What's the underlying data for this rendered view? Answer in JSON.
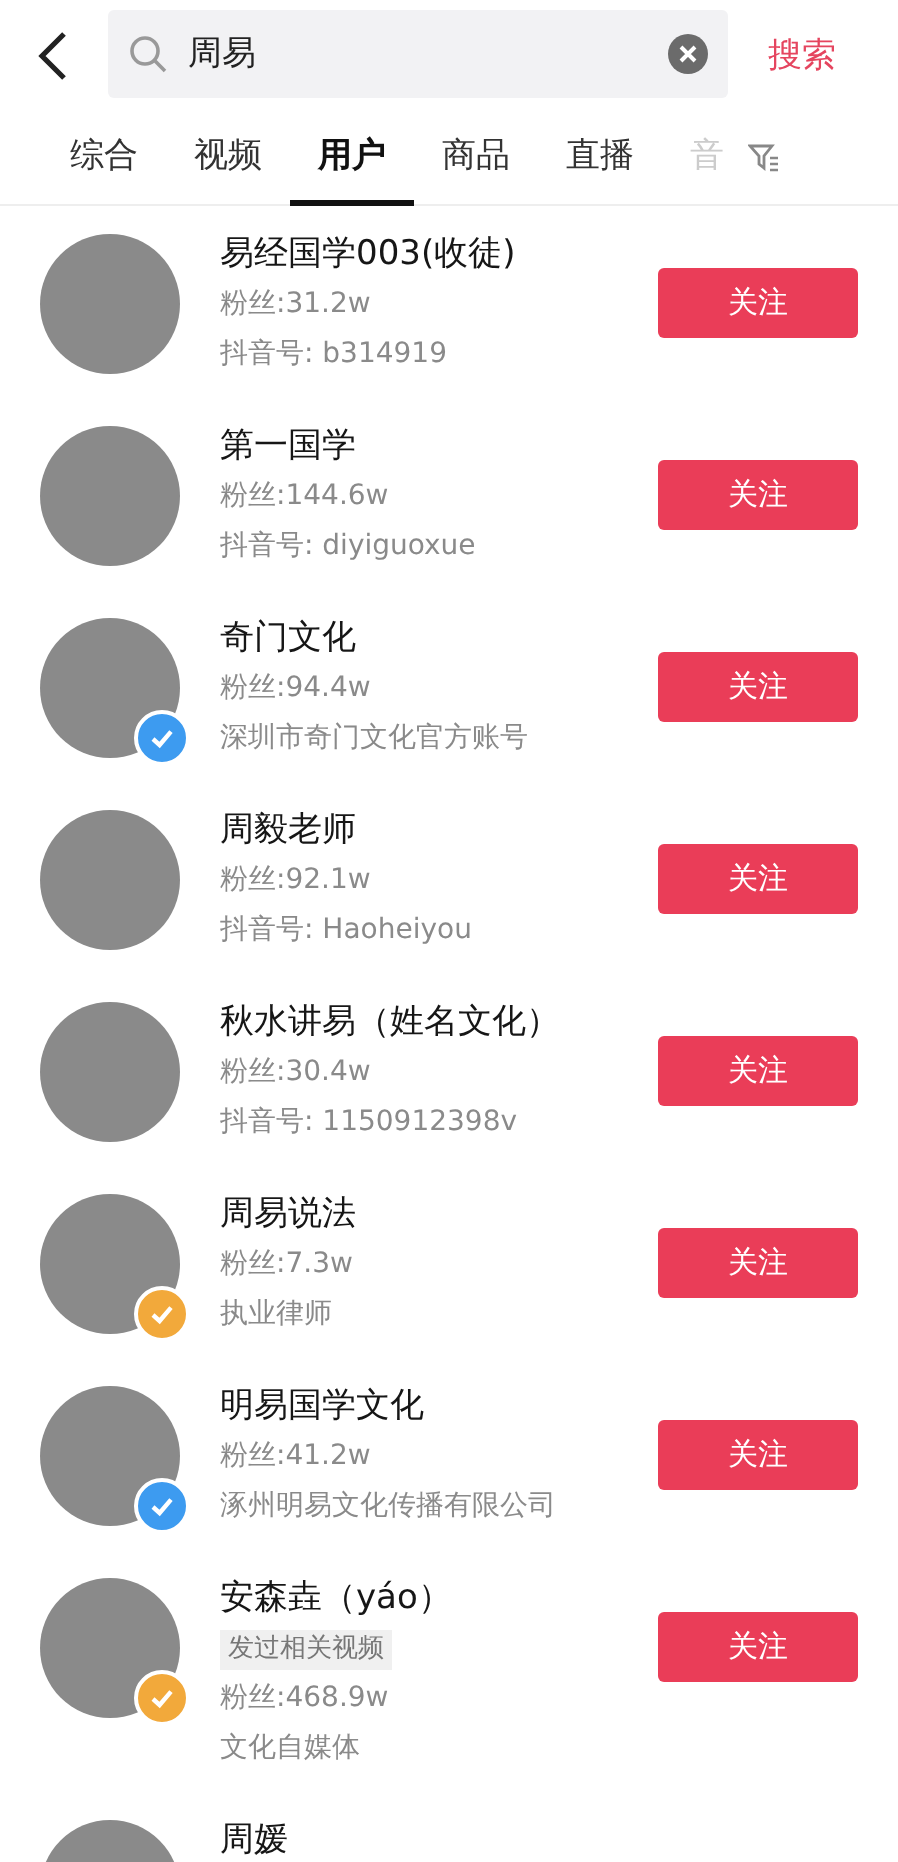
{
  "search": {
    "value": "周易",
    "action": "搜索"
  },
  "tabs": [
    {
      "label": "综合",
      "selected": false,
      "faded": false
    },
    {
      "label": "视频",
      "selected": false,
      "faded": false
    },
    {
      "label": "用户",
      "selected": true,
      "faded": false
    },
    {
      "label": "商品",
      "selected": false,
      "faded": false
    },
    {
      "label": "直播",
      "selected": false,
      "faded": false
    },
    {
      "label": "音",
      "selected": false,
      "faded": true
    }
  ],
  "users": [
    {
      "name": "易经国学003(收徒)",
      "fans": "粉丝:31.2w",
      "info": "抖音号: b314919",
      "button": "关注"
    },
    {
      "name": "第一国学",
      "fans": "粉丝:144.6w",
      "info": "抖音号: diyiguoxue",
      "button": "关注"
    },
    {
      "name": "奇门文化",
      "fans": "粉丝:94.4w",
      "info": "深圳市奇门文化官方账号",
      "button": "关注",
      "badge": {
        "color": "#3d9bf0"
      }
    },
    {
      "name": "周毅老师",
      "fans": "粉丝:92.1w",
      "info": "抖音号: Haoheiyou",
      "button": "关注"
    },
    {
      "name": "秋水讲易（姓名文化）",
      "fans": "粉丝:30.4w",
      "info": "抖音号: 1150912398v",
      "button": "关注"
    },
    {
      "name": "周易说法",
      "fans": "粉丝:7.3w",
      "info": "执业律师",
      "button": "关注",
      "badge": {
        "color": "#f2a93b"
      }
    },
    {
      "name": "明易国学文化",
      "fans": "粉丝:41.2w",
      "info": "涿州明易文化传播有限公司",
      "button": "关注",
      "badge": {
        "color": "#3d9bf0"
      }
    },
    {
      "name": "安森垚（yáo）",
      "tag": "发过相关视频",
      "fans": "粉丝:468.9w",
      "info": "文化自媒体",
      "button": "关注",
      "badge": {
        "color": "#f2a93b"
      }
    },
    {
      "name": "周媛"
    }
  ]
}
